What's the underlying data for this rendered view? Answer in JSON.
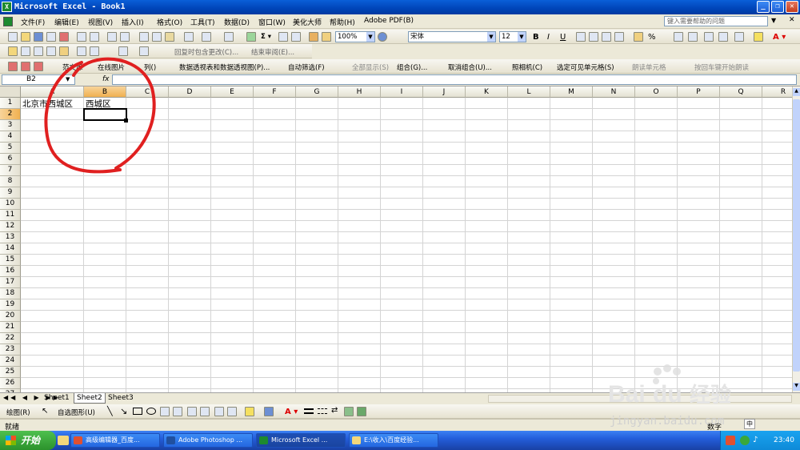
{
  "window": {
    "title": "Microsoft Excel - Book1"
  },
  "menu": [
    "文件(F)",
    "编辑(E)",
    "视图(V)",
    "插入(I)",
    "格式(O)",
    "工具(T)",
    "数据(D)",
    "窗口(W)",
    "美化大师",
    "帮助(H)",
    "Adobe PDF(B)"
  ],
  "help_placeholder": "键入需要帮助的问题",
  "toolbar1": {
    "zoom": "100%",
    "font": "宋体",
    "size": "12",
    "bold": "B",
    "italic": "I",
    "underline": "U",
    "percent": "%"
  },
  "toolbar2": {
    "reply_changes": "回复时包含更改(C)...",
    "end_review": "结束审阅(E)..."
  },
  "toolbar3": {
    "items": [
      "范文库",
      "在线图片",
      "列()",
      "数据透视表和数据透视图(P)...",
      "自动筛选(F)",
      "全部显示(S)",
      "组合(G)...",
      "取消组合(U)...",
      "照相机(C)",
      "选定可见单元格(S)",
      "朗读单元格",
      "按回车键开始朗读"
    ]
  },
  "formula_bar": {
    "name_box": "B2",
    "fx": "fx",
    "content": ""
  },
  "columns": [
    "A",
    "B",
    "C",
    "D",
    "E",
    "F",
    "G",
    "H",
    "I",
    "J",
    "K",
    "L",
    "M",
    "N",
    "O",
    "P",
    "Q",
    "R"
  ],
  "rows": [
    "1",
    "2",
    "3",
    "4",
    "5",
    "6",
    "7",
    "8",
    "9",
    "10",
    "11",
    "12",
    "13",
    "14",
    "15",
    "16",
    "17",
    "18",
    "19",
    "20",
    "21",
    "22",
    "23",
    "24",
    "25",
    "26",
    "27"
  ],
  "cells": {
    "A1": "北京市西城区",
    "B1": "西城区"
  },
  "selected_cell": "B2",
  "sheets": [
    "Sheet1",
    "Sheet2",
    "Sheet3"
  ],
  "active_sheet": "Sheet2",
  "draw_toolbar": {
    "draw": "绘图(R)",
    "autoshapes": "自选图形(U)"
  },
  "status": {
    "left": "就绪",
    "right": "数字"
  },
  "taskbar": {
    "start": "开始",
    "tasks": [
      "高级编辑器_百度...",
      "Adobe Photoshop ...",
      "Microsoft Excel ...",
      "E:\\收入\\百度经验..."
    ],
    "clock": "23:40",
    "ime": "中"
  },
  "watermark": {
    "brand": "Bai",
    "brand2": "经验",
    "url": "jingyan.baidu.com"
  },
  "colors": {
    "title_bar": "#0a5fd8",
    "selection_header": "#f0b050",
    "annotation": "#e02020",
    "taskbar": "#245edb",
    "start": "#3aa83a"
  }
}
